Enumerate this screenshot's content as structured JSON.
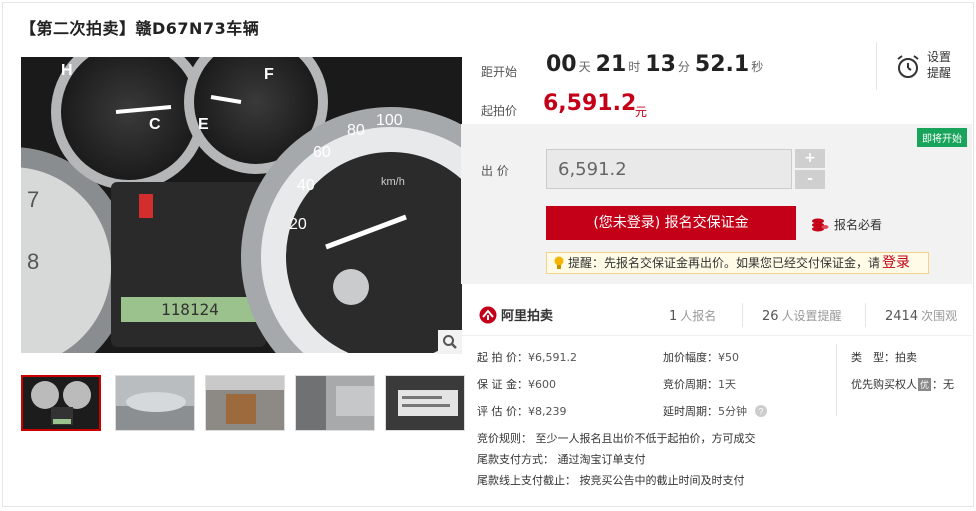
{
  "title": "【第二次拍卖】赣D67N73车辆",
  "photo": {
    "gauge_labels": [
      "H",
      "C",
      "E",
      "F",
      "80",
      "100",
      "60",
      "40",
      "20",
      "7",
      "8",
      "km/h"
    ],
    "odometer": "118124"
  },
  "countdown": {
    "label": "距开始",
    "days": "00",
    "days_unit": "天",
    "hours": "21",
    "hours_unit": "时",
    "minutes": "13",
    "minutes_unit": "分",
    "seconds": "52.1",
    "seconds_unit": "秒"
  },
  "remind": {
    "label": "设置提醒"
  },
  "start_price": {
    "label": "起拍价",
    "value": "6,591.2",
    "unit": "元"
  },
  "badge": "即将开始",
  "bid": {
    "label": "出 价",
    "value": "6,591.2",
    "plus": "+",
    "minus": "-",
    "register_button": "(您未登录) 报名交保证金",
    "must_read": "报名必看",
    "tip_text": "提醒：先报名交保证金再出价。如果您已经交付保证金，请",
    "tip_login": "登录"
  },
  "stats": {
    "brand": "阿里拍卖",
    "signups_count": "1",
    "signups_label": "人报名",
    "reminders_count": "26",
    "reminders_label": "人设置提醒",
    "views_count": "2414",
    "views_label": "次围观"
  },
  "info": {
    "start_price": {
      "k": "起 拍 价：",
      "v": "¥6,591.2"
    },
    "deposit": {
      "k": "保 证 金：",
      "v": "¥600"
    },
    "appraisal": {
      "k": "评 估 价：",
      "v": "¥8,239"
    },
    "increment": {
      "k": "加价幅度：",
      "v": "¥50"
    },
    "cycle": {
      "k": "竞价周期：",
      "v": "1天"
    },
    "delay": {
      "k": "延时周期：",
      "v": "5分钟"
    },
    "type": {
      "k": "类　型：",
      "v": "拍卖"
    },
    "priority": {
      "k": "优先购买权人",
      "badge": "优",
      "v": "：无"
    }
  },
  "rules": {
    "rule": "竞价规则：  至少一人报名且出价不低于起拍价，方可成交",
    "payment": "尾款支付方式：   通过淘宝订单支付",
    "deadline": "尾款线上支付截止：  按竞买公告中的截止时间及时支付"
  },
  "colors": {
    "accent": "#c40018",
    "badge_green": "#19a45b"
  }
}
